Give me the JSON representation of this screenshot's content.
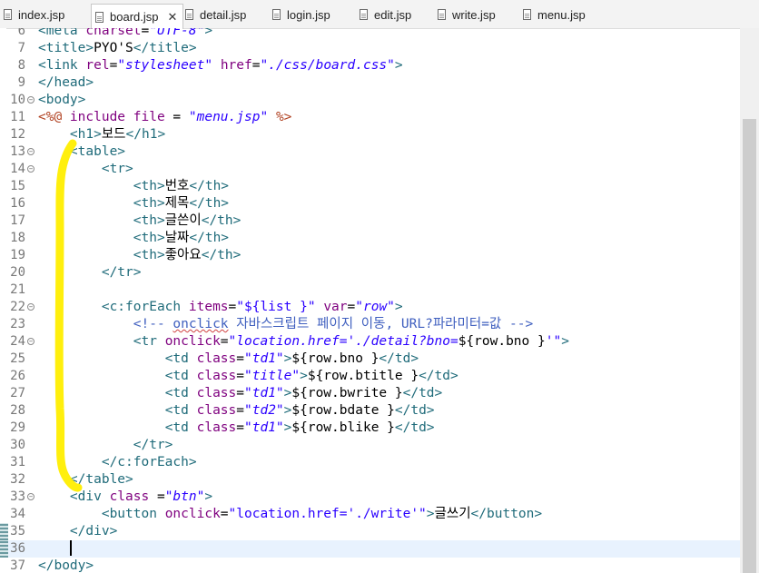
{
  "tabs": [
    {
      "label": "index.jsp",
      "active": false
    },
    {
      "label": "board.jsp",
      "active": true,
      "close": "✕"
    },
    {
      "label": "detail.jsp",
      "active": false
    },
    {
      "label": "login.jsp",
      "active": false
    },
    {
      "label": "edit.jsp",
      "active": false
    },
    {
      "label": "write.jsp",
      "active": false
    },
    {
      "label": "menu.jsp",
      "active": false
    }
  ],
  "editor": {
    "current_line": 36,
    "annotation_color": "#ffee00",
    "lines": [
      {
        "n": "6",
        "fold": false,
        "segs": [
          [
            "tag",
            "<meta "
          ],
          [
            "attr",
            "charset"
          ],
          [
            "txt",
            "="
          ],
          [
            "str",
            "\"UTF-8\""
          ],
          [
            "tag",
            ">"
          ]
        ]
      },
      {
        "n": "7",
        "fold": false,
        "segs": [
          [
            "tag",
            "<title>"
          ],
          [
            "txt",
            "PYO'S"
          ],
          [
            "tag",
            "</title>"
          ]
        ]
      },
      {
        "n": "8",
        "fold": false,
        "segs": [
          [
            "tag",
            "<link "
          ],
          [
            "attr",
            "rel"
          ],
          [
            "txt",
            "="
          ],
          [
            "str",
            "\"stylesheet\""
          ],
          [
            "txt",
            " "
          ],
          [
            "attr",
            "href"
          ],
          [
            "txt",
            "="
          ],
          [
            "str",
            "\"./css/board.css\""
          ],
          [
            "tag",
            ">"
          ]
        ]
      },
      {
        "n": "9",
        "fold": false,
        "segs": [
          [
            "tag",
            "</head>"
          ]
        ]
      },
      {
        "n": "10",
        "fold": true,
        "segs": [
          [
            "tag",
            "<body>"
          ]
        ]
      },
      {
        "n": "11",
        "fold": false,
        "segs": [
          [
            "jsp",
            "<%@ "
          ],
          [
            "attr",
            "include"
          ],
          [
            "txt",
            " "
          ],
          [
            "attr",
            "file"
          ],
          [
            "txt",
            " = "
          ],
          [
            "str",
            "\"menu.jsp\""
          ],
          [
            "txt",
            " "
          ],
          [
            "jsp",
            "%>"
          ]
        ]
      },
      {
        "n": "12",
        "fold": false,
        "segs": [
          [
            "txt",
            "    "
          ],
          [
            "tag",
            "<h1>"
          ],
          [
            "txt",
            "보드"
          ],
          [
            "tag",
            "</h1>"
          ]
        ]
      },
      {
        "n": "13",
        "fold": true,
        "segs": [
          [
            "txt",
            "    "
          ],
          [
            "tag",
            "<table>"
          ]
        ]
      },
      {
        "n": "14",
        "fold": true,
        "segs": [
          [
            "txt",
            "        "
          ],
          [
            "tag",
            "<tr>"
          ]
        ]
      },
      {
        "n": "15",
        "fold": false,
        "segs": [
          [
            "txt",
            "            "
          ],
          [
            "tag",
            "<th>"
          ],
          [
            "txt",
            "번호"
          ],
          [
            "tag",
            "</th>"
          ]
        ]
      },
      {
        "n": "16",
        "fold": false,
        "segs": [
          [
            "txt",
            "            "
          ],
          [
            "tag",
            "<th>"
          ],
          [
            "txt",
            "제목"
          ],
          [
            "tag",
            "</th>"
          ]
        ]
      },
      {
        "n": "17",
        "fold": false,
        "segs": [
          [
            "txt",
            "            "
          ],
          [
            "tag",
            "<th>"
          ],
          [
            "txt",
            "글쓴이"
          ],
          [
            "tag",
            "</th>"
          ]
        ]
      },
      {
        "n": "18",
        "fold": false,
        "segs": [
          [
            "txt",
            "            "
          ],
          [
            "tag",
            "<th>"
          ],
          [
            "txt",
            "날짜"
          ],
          [
            "tag",
            "</th>"
          ]
        ]
      },
      {
        "n": "19",
        "fold": false,
        "segs": [
          [
            "txt",
            "            "
          ],
          [
            "tag",
            "<th>"
          ],
          [
            "txt",
            "좋아요"
          ],
          [
            "tag",
            "</th>"
          ]
        ]
      },
      {
        "n": "20",
        "fold": false,
        "segs": [
          [
            "txt",
            "        "
          ],
          [
            "tag",
            "</tr>"
          ]
        ]
      },
      {
        "n": "21",
        "fold": false,
        "segs": []
      },
      {
        "n": "22",
        "fold": true,
        "segs": [
          [
            "txt",
            "        "
          ],
          [
            "tag",
            "<c:forEach "
          ],
          [
            "attr",
            "items"
          ],
          [
            "txt",
            "="
          ],
          [
            "stri",
            "\"${list }\""
          ],
          [
            "txt",
            " "
          ],
          [
            "attr",
            "var"
          ],
          [
            "txt",
            "="
          ],
          [
            "str",
            "\"row\""
          ],
          [
            "tag",
            ">"
          ]
        ]
      },
      {
        "n": "23",
        "fold": false,
        "segs": [
          [
            "txt",
            "            "
          ],
          [
            "cmt",
            "<!-- "
          ],
          [
            "cmt sq",
            "onclick"
          ],
          [
            "cmt",
            " 자바스크립트 페이지 이동, URL?파라미터=값 -->"
          ]
        ]
      },
      {
        "n": "24",
        "fold": true,
        "segs": [
          [
            "txt",
            "            "
          ],
          [
            "tag",
            "<tr "
          ],
          [
            "attr",
            "onclick"
          ],
          [
            "txt",
            "="
          ],
          [
            "str",
            "\"location.href='./detail?bno="
          ],
          [
            "txt",
            "${row.bno }"
          ],
          [
            "str",
            "'\""
          ],
          [
            "tag",
            ">"
          ]
        ]
      },
      {
        "n": "25",
        "fold": false,
        "segs": [
          [
            "txt",
            "                "
          ],
          [
            "tag",
            "<td "
          ],
          [
            "attr",
            "class"
          ],
          [
            "txt",
            "="
          ],
          [
            "str",
            "\"td1\""
          ],
          [
            "tag",
            ">"
          ],
          [
            "txt",
            "${row.bno }"
          ],
          [
            "tag",
            "</td>"
          ]
        ]
      },
      {
        "n": "26",
        "fold": false,
        "segs": [
          [
            "txt",
            "                "
          ],
          [
            "tag",
            "<td "
          ],
          [
            "attr",
            "class"
          ],
          [
            "txt",
            "="
          ],
          [
            "str",
            "\"title\""
          ],
          [
            "tag",
            ">"
          ],
          [
            "txt",
            "${row.btitle }"
          ],
          [
            "tag",
            "</td>"
          ]
        ]
      },
      {
        "n": "27",
        "fold": false,
        "segs": [
          [
            "txt",
            "                "
          ],
          [
            "tag",
            "<td "
          ],
          [
            "attr",
            "class"
          ],
          [
            "txt",
            "="
          ],
          [
            "str",
            "\"td1\""
          ],
          [
            "tag",
            ">"
          ],
          [
            "txt",
            "${row.bwrite }"
          ],
          [
            "tag",
            "</td>"
          ]
        ]
      },
      {
        "n": "28",
        "fold": false,
        "segs": [
          [
            "txt",
            "                "
          ],
          [
            "tag",
            "<td "
          ],
          [
            "attr",
            "class"
          ],
          [
            "txt",
            "="
          ],
          [
            "str",
            "\"td2\""
          ],
          [
            "tag",
            ">"
          ],
          [
            "txt",
            "${row.bdate }"
          ],
          [
            "tag",
            "</td>"
          ]
        ]
      },
      {
        "n": "29",
        "fold": false,
        "segs": [
          [
            "txt",
            "                "
          ],
          [
            "tag",
            "<td "
          ],
          [
            "attr",
            "class"
          ],
          [
            "txt",
            "="
          ],
          [
            "str",
            "\"td1\""
          ],
          [
            "tag",
            ">"
          ],
          [
            "txt",
            "${row.blike }"
          ],
          [
            "tag",
            "</td>"
          ]
        ]
      },
      {
        "n": "30",
        "fold": false,
        "segs": [
          [
            "txt",
            "            "
          ],
          [
            "tag",
            "</tr>"
          ]
        ]
      },
      {
        "n": "31",
        "fold": false,
        "segs": [
          [
            "txt",
            "        "
          ],
          [
            "tag",
            "</c:forEach>"
          ]
        ]
      },
      {
        "n": "32",
        "fold": false,
        "segs": [
          [
            "txt",
            "    "
          ],
          [
            "tag",
            "</table>"
          ]
        ]
      },
      {
        "n": "33",
        "fold": true,
        "segs": [
          [
            "txt",
            "    "
          ],
          [
            "tag",
            "<div "
          ],
          [
            "attr",
            "class"
          ],
          [
            "txt",
            " ="
          ],
          [
            "str",
            "\"btn\""
          ],
          [
            "tag",
            ">"
          ]
        ]
      },
      {
        "n": "34",
        "fold": false,
        "segs": [
          [
            "txt",
            "        "
          ],
          [
            "tag",
            "<button "
          ],
          [
            "attr",
            "onclick"
          ],
          [
            "txt",
            "="
          ],
          [
            "stri",
            "\"location.href='./write'\""
          ],
          [
            "tag",
            ">"
          ],
          [
            "txt",
            "글쓰기"
          ],
          [
            "tag",
            "</button>"
          ]
        ]
      },
      {
        "n": "35",
        "fold": false,
        "segs": [
          [
            "txt",
            "    "
          ],
          [
            "tag",
            "</div>"
          ]
        ]
      },
      {
        "n": "36",
        "fold": false,
        "segs": [
          [
            "txt",
            "    "
          ]
        ]
      },
      {
        "n": "37",
        "fold": false,
        "segs": [
          [
            "tag",
            "</body>"
          ]
        ]
      }
    ]
  }
}
